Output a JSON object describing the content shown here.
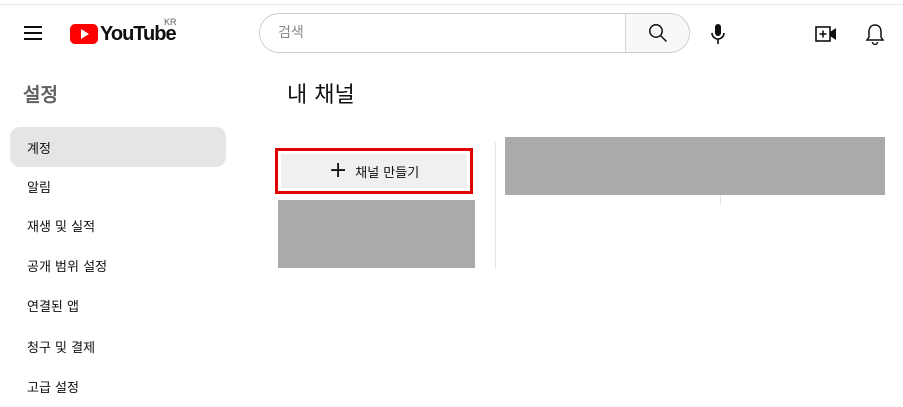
{
  "header": {
    "logo_text": "YouTube",
    "country_code": "KR",
    "search_placeholder": "검색"
  },
  "icons": {
    "menu": "hamburger-menu-icon",
    "search": "search-icon",
    "mic": "microphone-icon",
    "create": "video-add-icon",
    "notifications": "bell-icon",
    "add": "plus-icon"
  },
  "colors": {
    "brand_red": "#ff0000",
    "highlight_border": "#e00000",
    "placeholder_gray": "#aaaaaa",
    "active_item_bg": "#e5e5e5"
  },
  "sidebar": {
    "title": "설정",
    "items": [
      {
        "label": "계정",
        "active": true
      },
      {
        "label": "알림"
      },
      {
        "label": "재생 및 실적"
      },
      {
        "label": "공개 범위 설정"
      },
      {
        "label": "연결된 앱"
      },
      {
        "label": "청구 및 결제"
      },
      {
        "label": "고급 설정"
      }
    ]
  },
  "main": {
    "title": "내 채널",
    "create_channel_label": "채널 만들기"
  }
}
